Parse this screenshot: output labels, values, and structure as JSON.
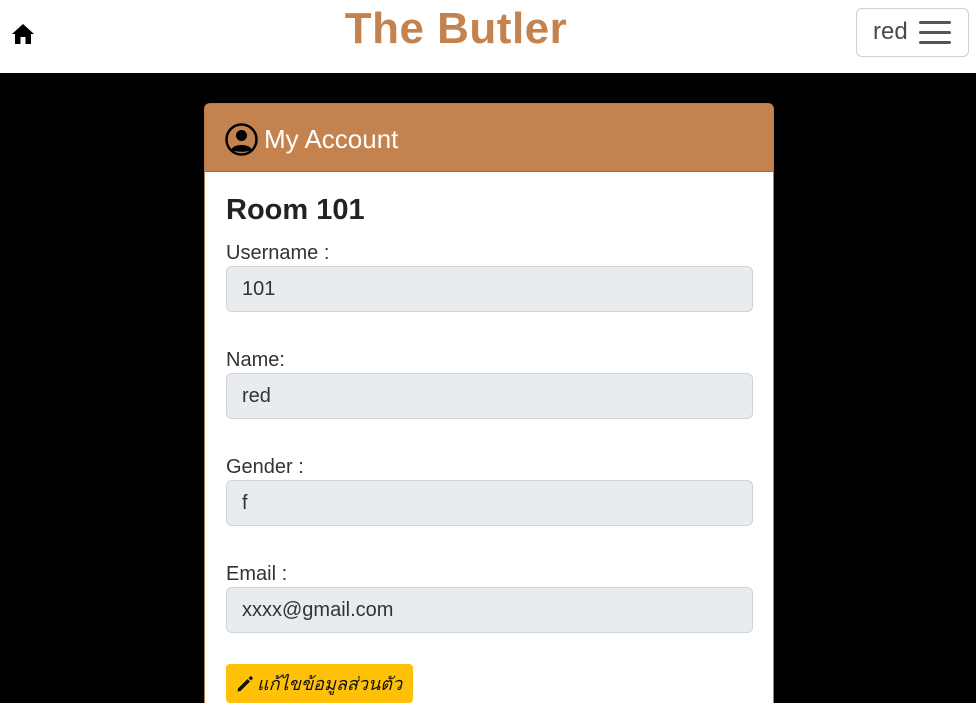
{
  "navbar": {
    "home_icon": "home-icon",
    "brand": "The Butler",
    "user_name": "red",
    "menu_icon": "hamburger-icon",
    "brand_color": "#c4834e"
  },
  "card": {
    "header_icon": "user-circle-icon",
    "title": "My Account",
    "room": "Room 101",
    "fields": {
      "username": {
        "label": "Username :",
        "value": "101"
      },
      "name": {
        "label": "Name:",
        "value": "red"
      },
      "gender": {
        "label": "Gender :",
        "value": "f"
      },
      "email": {
        "label": "Email :",
        "value": "xxxx@gmail.com"
      }
    },
    "edit_button": {
      "icon": "pencil-icon",
      "label": "แก้ไขข้อมูลส่วนตัว"
    },
    "header_color": "#c4834e",
    "button_color": "#ffc107"
  }
}
